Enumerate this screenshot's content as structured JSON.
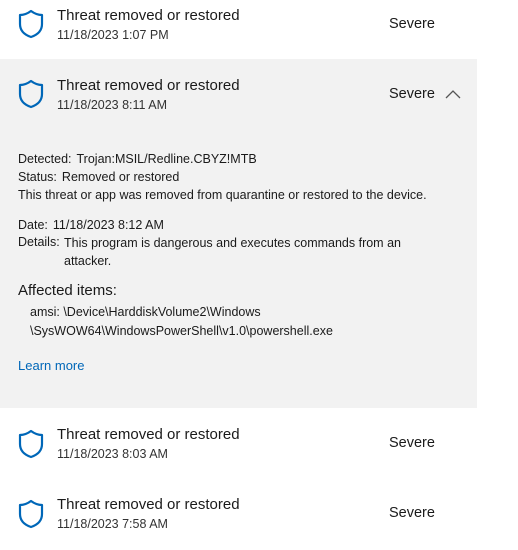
{
  "items": [
    {
      "title": "Threat removed or restored",
      "date": "11/18/2023 1:07 PM",
      "severity": "Severe",
      "icon": "shield-icon"
    },
    {
      "title": "Threat removed or restored",
      "date": "11/18/2023 8:11 AM",
      "severity": "Severe",
      "icon": "shield-icon"
    },
    {
      "title": "Threat removed or restored",
      "date": "11/18/2023 8:03 AM",
      "severity": "Severe",
      "icon": "shield-icon"
    },
    {
      "title": "Threat removed or restored",
      "date": "11/18/2023 7:58 AM",
      "severity": "Severe",
      "icon": "shield-icon"
    }
  ],
  "expanded": {
    "detected_label": "Detected:",
    "detected_value": "Trojan:MSIL/Redline.CBYZ!MTB",
    "status_label": "Status:",
    "status_value": "Removed or restored",
    "description": "This threat or app was removed from quarantine or restored to the device.",
    "date_label": "Date:",
    "date_value": "11/18/2023 8:12 AM",
    "details_label": "Details:",
    "details_value": "This program is dangerous and executes commands from an attacker.",
    "affected_heading": "Affected items:",
    "affected_path_line1": "amsi: \\Device\\HarddiskVolume2\\Windows",
    "affected_path_line2": "\\SysWOW64\\WindowsPowerShell\\v1.0\\powershell.exe",
    "learn_more": "Learn more"
  },
  "colors": {
    "accent": "#0067b8",
    "expanded_bg": "#f2f2f2",
    "text": "#1a1a1a"
  }
}
